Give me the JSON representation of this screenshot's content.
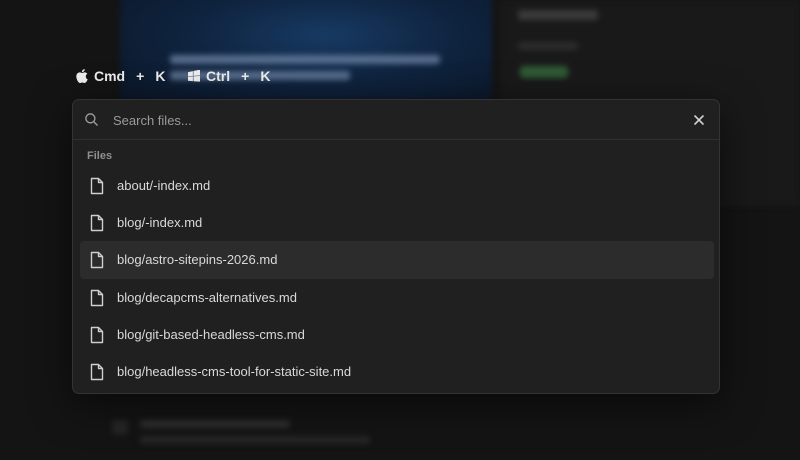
{
  "shortcuts": [
    {
      "icon": "apple-icon",
      "modifier": "Cmd",
      "plus": "+",
      "key": "K"
    },
    {
      "icon": "windows-icon",
      "modifier": "Ctrl",
      "plus": "+",
      "key": "K"
    }
  ],
  "palette": {
    "search_placeholder": "Search files...",
    "search_value": "",
    "section_label": "Files",
    "files": [
      {
        "name": "about/-index.md",
        "icon": "file-icon",
        "active": false
      },
      {
        "name": "blog/-index.md",
        "icon": "file-icon",
        "active": false
      },
      {
        "name": "blog/astro-sitepins-2026.md",
        "icon": "file-icon",
        "active": true
      },
      {
        "name": "blog/decapcms-alternatives.md",
        "icon": "file-icon",
        "active": false
      },
      {
        "name": "blog/git-based-headless-cms.md",
        "icon": "file-icon",
        "active": false
      },
      {
        "name": "blog/headless-cms-tool-for-static-site.md",
        "icon": "file-icon",
        "active": false
      }
    ]
  },
  "colors": {
    "background": "#141414",
    "palette_bg": "#202020",
    "active_row": "#2c2c2c",
    "muted_text": "#8f8f8f"
  }
}
